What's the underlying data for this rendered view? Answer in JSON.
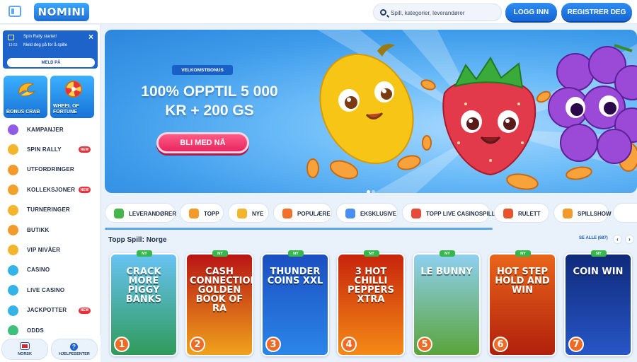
{
  "header": {
    "logo_text": "NOMINI",
    "search_placeholder": "Spill, kategorier, leverandører",
    "login_label": "LOGG INN",
    "register_label": "REGISTRER DEG"
  },
  "sidebar": {
    "notice": {
      "title": "Spin Rally startet!",
      "time": "13:53",
      "body": "Meld deg på for å spille",
      "button_label": "MELD PÅ"
    },
    "promo_tiles": [
      {
        "label": "BONUS CRAB",
        "icon": "crab-claw-icon"
      },
      {
        "label": "WHEEL OF FORTUNE",
        "icon": "fortune-wheel-icon"
      }
    ],
    "items": [
      {
        "label": "KAMPANJER",
        "icon": "gift-icon",
        "badge": "",
        "color": "#8f5ce6"
      },
      {
        "label": "SPIN RALLY",
        "icon": "flag-icon",
        "badge": "NEW",
        "color": "#f2b52c"
      },
      {
        "label": "UTFORDRINGER",
        "icon": "target-icon",
        "badge": "",
        "color": "#f29a2c"
      },
      {
        "label": "KOLLEKSJONER",
        "icon": "cards-icon",
        "badge": "NEW",
        "color": "#f2a22c"
      },
      {
        "label": "TURNERINGER",
        "icon": "trophy-icon",
        "badge": "",
        "color": "#f2b52c"
      },
      {
        "label": "BUTIKK",
        "icon": "shop-icon",
        "badge": "",
        "color": "#f29a2c"
      },
      {
        "label": "VIP NIVÅER",
        "icon": "crown-icon",
        "badge": "",
        "color": "#f2b52c"
      },
      {
        "label": "CASINO",
        "icon": "clover-icon",
        "badge": "",
        "color": "#33b3e8"
      },
      {
        "label": "LIVE CASINO",
        "icon": "live-icon",
        "badge": "",
        "color": "#33b3e8"
      },
      {
        "label": "JACKPOTTER",
        "icon": "jackpot-icon",
        "badge": "NEW",
        "color": "#33b3e8"
      },
      {
        "label": "ODDS",
        "icon": "ball-icon",
        "badge": "",
        "color": "#3fc07a"
      }
    ],
    "footer": {
      "language_label": "NORSK",
      "help_label": "HJELPESENTER"
    }
  },
  "hero": {
    "badge": "VELKOMSTBONUS",
    "title_line1": "100% OPPTIL 5 000",
    "title_line2": "KR + 200 GS",
    "cta_label": "BLI MED NÅ"
  },
  "categories": [
    {
      "label": "LEVERANDØRER",
      "icon": "provider-icon",
      "color": "#45b649"
    },
    {
      "label": "TOPP",
      "icon": "crown-icon",
      "color": "#f29a2c"
    },
    {
      "label": "NYE",
      "icon": "lightning-icon",
      "color": "#f2b52c"
    },
    {
      "label": "POPULÆRE",
      "icon": "fire-icon",
      "color": "#f2702c"
    },
    {
      "label": "EKSKLUSIVE",
      "icon": "diamond-icon",
      "color": "#4a8ff0"
    },
    {
      "label": "TOPP LIVE CASINOSPILL",
      "icon": "dice-icon",
      "color": "#e84a3a"
    },
    {
      "label": "RULETT",
      "icon": "roulette-icon",
      "color": "#e8532c"
    },
    {
      "label": "SPILLSHOW",
      "icon": "show-icon",
      "color": "#f29a2c"
    }
  ],
  "games_section": {
    "title": "Topp Spill: Norge",
    "see_all": "SE ALLE (687)",
    "badge": "NY",
    "games": [
      {
        "title": "CRACK MORE PIGGY BANKS",
        "rank": "1",
        "color_top": "#67c3f3",
        "color_bottom": "#2f9a5a"
      },
      {
        "title": "CASH CONNECTION GOLDEN BOOK OF RA",
        "rank": "2",
        "color_top": "#b81414",
        "color_bottom": "#f0a21c"
      },
      {
        "title": "THUNDER COINS XXL",
        "rank": "3",
        "color_top": "#1b4fc2",
        "color_bottom": "#2b86e8"
      },
      {
        "title": "3 HOT CHILLI PEPPERS XTRA",
        "rank": "4",
        "color_top": "#c7250c",
        "color_bottom": "#f58a16"
      },
      {
        "title": "LE BUNNY",
        "rank": "5",
        "color_top": "#8fd0f0",
        "color_bottom": "#5aa43a"
      },
      {
        "title": "HOT STEP HOLD AND WIN",
        "rank": "6",
        "color_top": "#e9651a",
        "color_bottom": "#b0200c"
      },
      {
        "title": "COIN WIN",
        "rank": "7",
        "color_top": "#0f2a7a",
        "color_bottom": "#2756c7"
      }
    ]
  },
  "colors": {
    "primary": "#1565d4",
    "accent_pink": "#e8265e",
    "new_badge": "#e8313a",
    "ny_badge": "#36b84b"
  }
}
